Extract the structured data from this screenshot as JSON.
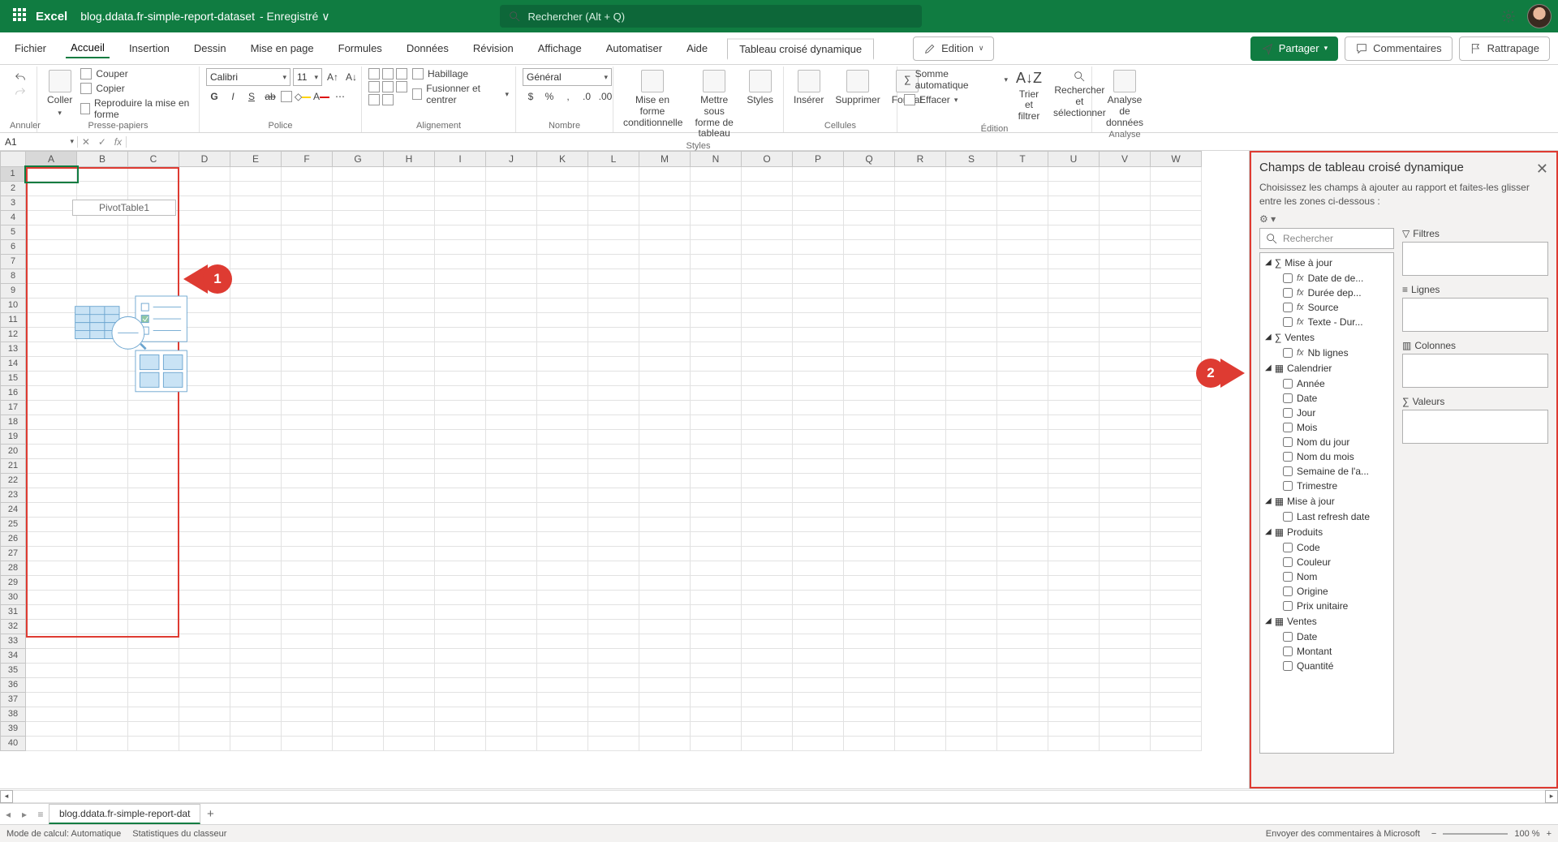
{
  "app": {
    "name": "Excel",
    "doc": "blog.ddata.fr-simple-report-dataset",
    "saved": "- Enregistré ∨",
    "search_ph": "Rechercher (Alt + Q)"
  },
  "tabs": {
    "fichier": "Fichier",
    "accueil": "Accueil",
    "insertion": "Insertion",
    "dessin": "Dessin",
    "miseenpage": "Mise en page",
    "formules": "Formules",
    "donnees": "Données",
    "revision": "Révision",
    "affichage": "Affichage",
    "automatiser": "Automatiser",
    "aide": "Aide",
    "tcd": "Tableau croisé dynamique",
    "edition": "Edition",
    "partager": "Partager",
    "commentaires": "Commentaires",
    "rattrapage": "Rattrapage"
  },
  "rgroups": {
    "annuler": "Annuler",
    "presse": "Presse-papiers",
    "coller": "Coller",
    "couper": "Couper",
    "copier": "Copier",
    "repro": "Reproduire la mise en forme",
    "police": "Police",
    "font_name": "Calibri",
    "font_size": "11",
    "alignement": "Alignement",
    "habillage": "Habillage",
    "fusionner": "Fusionner et centrer",
    "nombre": "Nombre",
    "numfmt": "Général",
    "styles": "Styles",
    "mfcond": "Mise en forme conditionnelle",
    "tableau": "Mettre sous forme de tableau",
    "stylesbtn": "Styles",
    "cellules": "Cellules",
    "inserer": "Insérer",
    "supprimer": "Supprimer",
    "format": "Format",
    "edition_g": "Édition",
    "somme": "Somme automatique",
    "effacer": "Effacer",
    "trier": "Trier et filtrer",
    "rechercher": "Rechercher et sélectionner",
    "analyse": "Analyse",
    "analyse_donnees": "Analyse de données"
  },
  "formula": {
    "name_box": "A1"
  },
  "cols": [
    "A",
    "B",
    "C",
    "D",
    "E",
    "F",
    "G",
    "H",
    "I",
    "J",
    "K",
    "L",
    "M",
    "N",
    "O",
    "P",
    "Q",
    "R",
    "S",
    "T",
    "U",
    "V",
    "W"
  ],
  "pivot": {
    "title": "PivotTable1"
  },
  "callouts": {
    "c1": "1",
    "c2": "2"
  },
  "pane": {
    "title": "Champs de tableau croisé dynamique",
    "desc": "Choisissez les champs à ajouter au rapport et faites-les glisser entre les zones ci-dessous :",
    "search_ph": "Rechercher",
    "tables": [
      {
        "icon": "sigma",
        "name": "Mise à jour",
        "fields": [
          {
            "fx": true,
            "label": "Date de de..."
          },
          {
            "fx": true,
            "label": "Durée dep..."
          },
          {
            "fx": true,
            "label": "Source"
          },
          {
            "fx": true,
            "label": "Texte - Dur..."
          }
        ]
      },
      {
        "icon": "sigma",
        "name": "Ventes",
        "fields": [
          {
            "fx": true,
            "label": "Nb lignes"
          }
        ]
      },
      {
        "icon": "table",
        "name": "Calendrier",
        "fields": [
          {
            "label": "Année"
          },
          {
            "label": "Date"
          },
          {
            "label": "Jour"
          },
          {
            "label": "Mois"
          },
          {
            "label": "Nom du jour"
          },
          {
            "label": "Nom du mois"
          },
          {
            "label": "Semaine de l'a..."
          },
          {
            "label": "Trimestre"
          }
        ]
      },
      {
        "icon": "table",
        "name": "Mise à jour",
        "fields": [
          {
            "label": "Last refresh date"
          }
        ]
      },
      {
        "icon": "table",
        "name": "Produits",
        "fields": [
          {
            "label": "Code"
          },
          {
            "label": "Couleur"
          },
          {
            "label": "Nom"
          },
          {
            "label": "Origine"
          },
          {
            "label": "Prix unitaire"
          }
        ]
      },
      {
        "icon": "table",
        "name": "Ventes",
        "fields": [
          {
            "label": "Date"
          },
          {
            "label": "Montant"
          },
          {
            "label": "Quantité"
          }
        ]
      }
    ],
    "zones": {
      "filtres": "Filtres",
      "lignes": "Lignes",
      "colonnes": "Colonnes",
      "valeurs": "Valeurs"
    }
  },
  "sheets": {
    "name": "blog.ddata.fr-simple-report-dat"
  },
  "status": {
    "calc": "Mode de calcul: Automatique",
    "stats": "Statistiques du classeur",
    "feedback": "Envoyer des commentaires à Microsoft",
    "zoom": "100 %"
  }
}
